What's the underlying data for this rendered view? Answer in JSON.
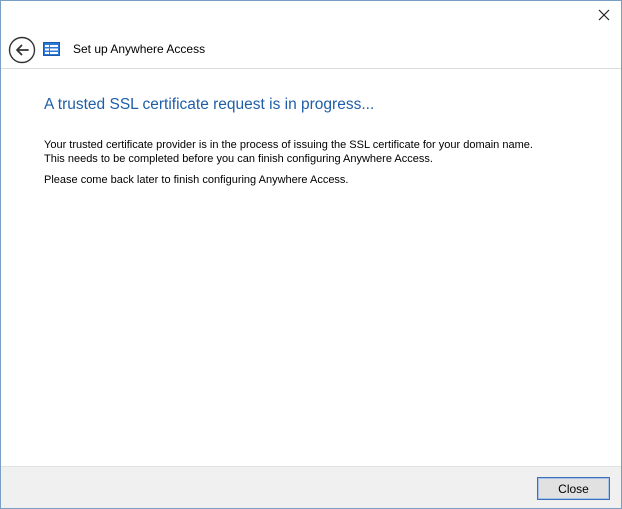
{
  "window": {
    "close_glyph": "✕"
  },
  "header": {
    "title": "Set up Anywhere Access",
    "back_icon": "back-arrow-icon",
    "app_icon": "remote-access-icon"
  },
  "content": {
    "heading": "A trusted SSL certificate request is in progress...",
    "paragraph1_line1": "Your trusted certificate provider is in the process of issuing the SSL certificate for your domain name.",
    "paragraph1_line2": "This needs to be completed before you can finish configuring Anywhere Access.",
    "paragraph2": "Please come back later to finish configuring Anywhere Access."
  },
  "footer": {
    "close_label": "Close"
  },
  "colors": {
    "accent": "#1f5ea8",
    "footer_bg": "#f0f0f0",
    "button_border": "#3c6fb5"
  }
}
